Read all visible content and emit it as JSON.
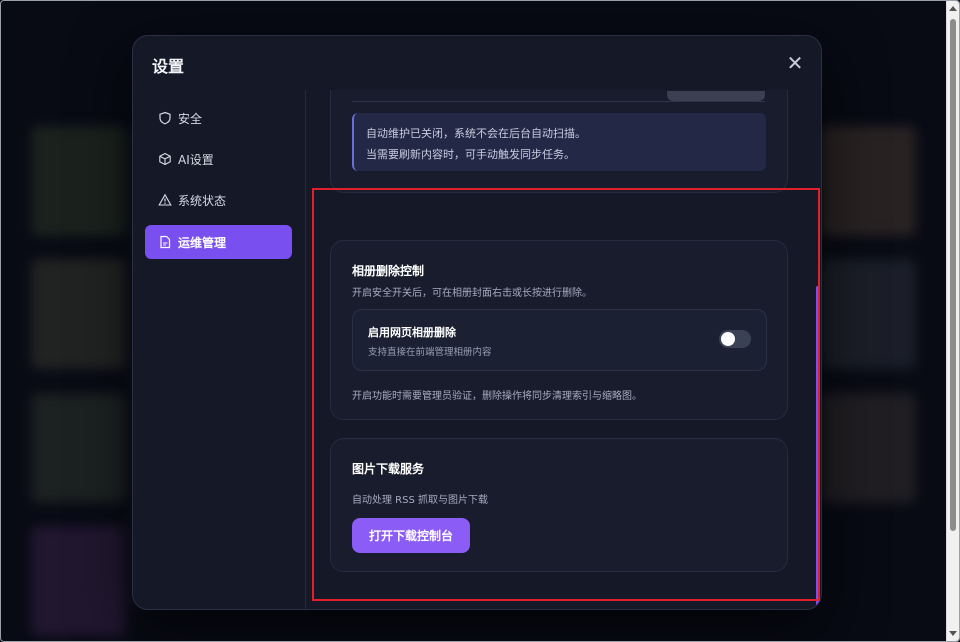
{
  "modal": {
    "title": "设置",
    "close_icon": "close-icon"
  },
  "sidebar": {
    "items": [
      {
        "label": "安全",
        "icon": "shield-icon",
        "active": false
      },
      {
        "label": "AI设置",
        "icon": "cube-icon",
        "active": false
      },
      {
        "label": "系统状态",
        "icon": "warning-icon",
        "active": false
      },
      {
        "label": "运维管理",
        "icon": "document-icon",
        "active": true
      }
    ]
  },
  "maintenance_notice": {
    "line1": "自动维护已关闭，系统不会在后台自动扫描。",
    "line2": "当需要刷新内容时，可手动触发同步任务。"
  },
  "album_delete": {
    "title": "相册删除控制",
    "description": "开启安全开关后，可在相册封面右击或长按进行删除。",
    "toggle_title": "启用网页相册删除",
    "toggle_subtitle": "支持直接在前端管理相册内容",
    "toggle_on": false,
    "footnote": "开启功能时需要管理员验证，删除操作将同步清理索引与缩略图。"
  },
  "image_download": {
    "title": "图片下载服务",
    "description": "自动处理 RSS 抓取与图片下载",
    "button_label": "打开下载控制台"
  },
  "colors": {
    "accent": "#8b5cf6",
    "active_nav": "#7a4ff0",
    "highlight_border": "#e0202a"
  }
}
